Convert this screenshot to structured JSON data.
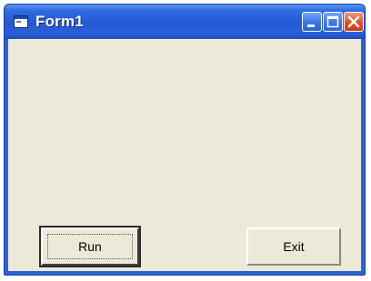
{
  "window": {
    "title": "Form1",
    "icon": "form-app-icon",
    "controls": {
      "minimize": "minimize-icon",
      "maximize": "maximize-icon",
      "close": "close-icon"
    },
    "colors": {
      "titlebar": "#2559d4",
      "client": "#ece9d8",
      "close": "#e0552c"
    }
  },
  "form": {
    "run_label": "Run",
    "exit_label": "Exit"
  }
}
